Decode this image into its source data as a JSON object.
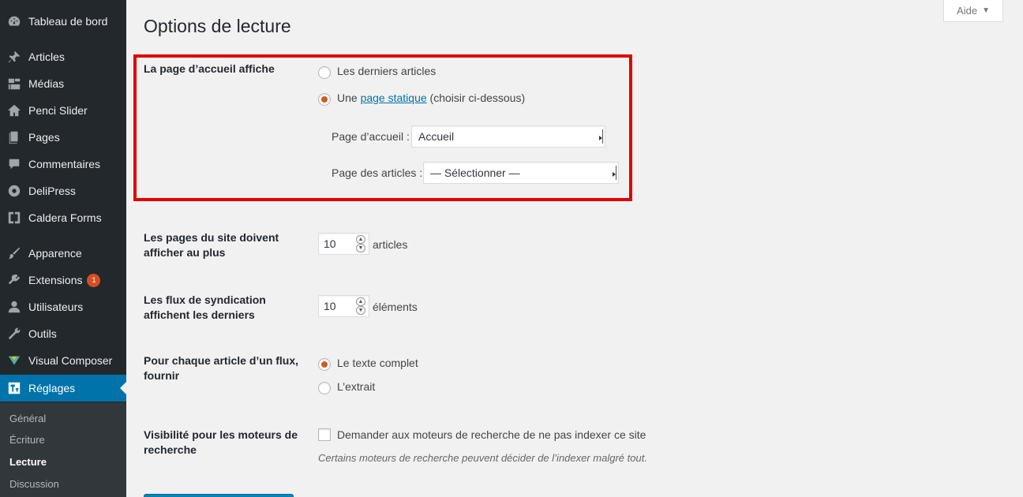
{
  "sidebar": {
    "items": [
      {
        "label": "Tableau de bord",
        "icon": "dashboard-icon"
      },
      {
        "label": "Articles",
        "icon": "pushpin-icon"
      },
      {
        "label": "Médias",
        "icon": "media-icon"
      },
      {
        "label": "Penci Slider",
        "icon": "home-icon"
      },
      {
        "label": "Pages",
        "icon": "pages-icon"
      },
      {
        "label": "Commentaires",
        "icon": "comment-icon"
      },
      {
        "label": "DeliPress",
        "icon": "delipress-icon"
      },
      {
        "label": "Caldera Forms",
        "icon": "caldera-icon"
      },
      {
        "label": "Apparence",
        "icon": "brush-icon"
      },
      {
        "label": "Extensions",
        "icon": "plugin-icon",
        "badge": "1"
      },
      {
        "label": "Utilisateurs",
        "icon": "user-icon"
      },
      {
        "label": "Outils",
        "icon": "wrench-icon"
      },
      {
        "label": "Visual Composer",
        "icon": "visual-composer-icon"
      },
      {
        "label": "Réglages",
        "icon": "settings-icon",
        "active": true
      }
    ],
    "submenu": [
      {
        "label": "Général"
      },
      {
        "label": "Écriture"
      },
      {
        "label": "Lecture",
        "current": true
      },
      {
        "label": "Discussion"
      }
    ]
  },
  "header": {
    "help_label": "Aide",
    "page_title": "Options de lecture"
  },
  "front_page": {
    "label": "La page d’accueil affiche",
    "option_latest": "Les derniers articles",
    "option_static_prefix": "Une",
    "option_static_link": "page statique",
    "option_static_suffix": "(choisir ci-dessous)",
    "homepage_label": "Page d’accueil :",
    "homepage_value": "Accueil",
    "posts_page_label": "Page des articles :",
    "posts_page_value": "— Sélectionner —"
  },
  "posts_per_page": {
    "label": "Les pages du site doivent afficher au plus",
    "value": "10",
    "unit": "articles"
  },
  "feeds": {
    "label": "Les flux de syndication affichent les derniers",
    "value": "10",
    "unit": "éléments"
  },
  "feed_content": {
    "label": "Pour chaque article d’un flux, fournir",
    "option_full": "Le texte complet",
    "option_summary": "L’extrait"
  },
  "visibility": {
    "label": "Visibilité pour les moteurs de recherche",
    "checkbox_label": "Demander aux moteurs de recherche de ne pas indexer ce site",
    "description": "Certains moteurs de recherche peuvent décider de l’indexer malgré tout."
  },
  "colors": {
    "sidebar_bg": "#23282d",
    "active_bg": "#0073aa",
    "highlight": "#e00000",
    "radio_checked": "#d05a2a",
    "link": "#0073aa"
  }
}
